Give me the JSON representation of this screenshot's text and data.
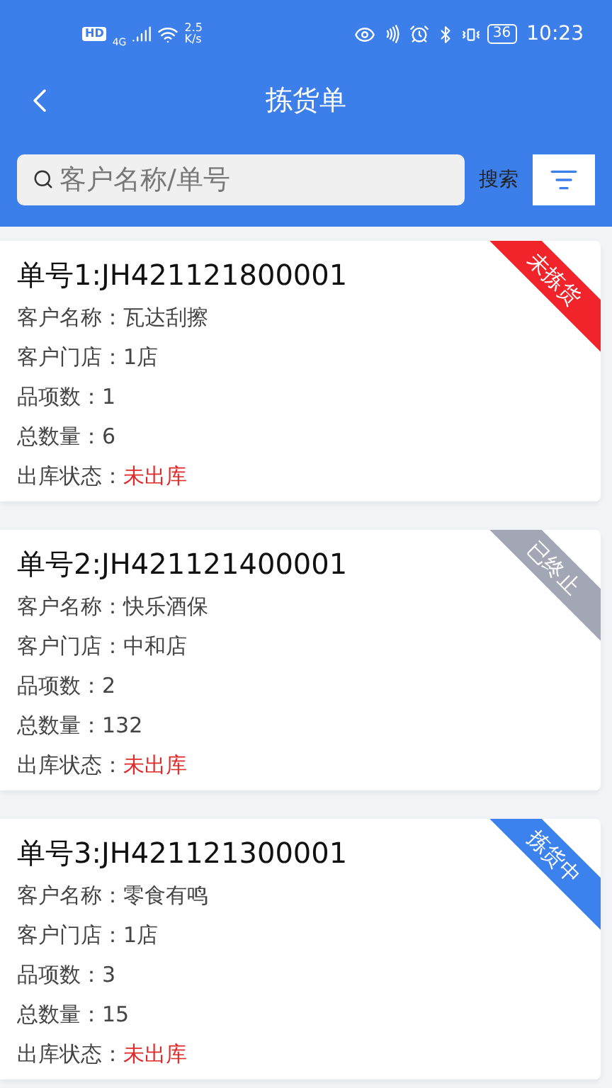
{
  "status_bar": {
    "hd": "HD",
    "network": "4G",
    "speed_value": "2.5",
    "speed_unit": "K/s",
    "battery": "36",
    "time": "10:23"
  },
  "header": {
    "title": "拣货单"
  },
  "search": {
    "placeholder": "客户名称/单号",
    "button": "搜索"
  },
  "orders": [
    {
      "number": "单号1:JH421121800001",
      "ribbon": {
        "text": "未拣货",
        "color": "#f0242a"
      },
      "fields": [
        {
          "label": "客户名称：",
          "value": "瓦达刮擦",
          "kind": "plain"
        },
        {
          "label": "客户门店：",
          "value": "1店",
          "kind": "plain"
        },
        {
          "label": "品项数：",
          "value": "1",
          "kind": "plain"
        },
        {
          "label": "总数量：",
          "value": "6",
          "kind": "plain"
        },
        {
          "label": "出库状态：",
          "value": "未出库",
          "kind": "alert"
        }
      ]
    },
    {
      "number": "单号2:JH421121400001",
      "ribbon": {
        "text": "已终止",
        "color": "#a3a6b4"
      },
      "fields": [
        {
          "label": "客户名称：",
          "value": "快乐酒保",
          "kind": "plain"
        },
        {
          "label": "客户门店：",
          "value": "中和店",
          "kind": "plain"
        },
        {
          "label": "品项数：",
          "value": "2",
          "kind": "plain"
        },
        {
          "label": "总数量：",
          "value": "132",
          "kind": "plain"
        },
        {
          "label": "出库状态：",
          "value": "未出库",
          "kind": "alert"
        }
      ]
    },
    {
      "number": "单号3:JH421121300001",
      "ribbon": {
        "text": "拣货中",
        "color": "#3b82ee"
      },
      "fields": [
        {
          "label": "客户名称：",
          "value": "零食有鸣",
          "kind": "plain"
        },
        {
          "label": "客户门店：",
          "value": "1店",
          "kind": "plain"
        },
        {
          "label": "品项数：",
          "value": "3",
          "kind": "plain"
        },
        {
          "label": "总数量：",
          "value": "15",
          "kind": "plain"
        },
        {
          "label": "出库状态：",
          "value": "未出库",
          "kind": "alert"
        }
      ]
    }
  ]
}
